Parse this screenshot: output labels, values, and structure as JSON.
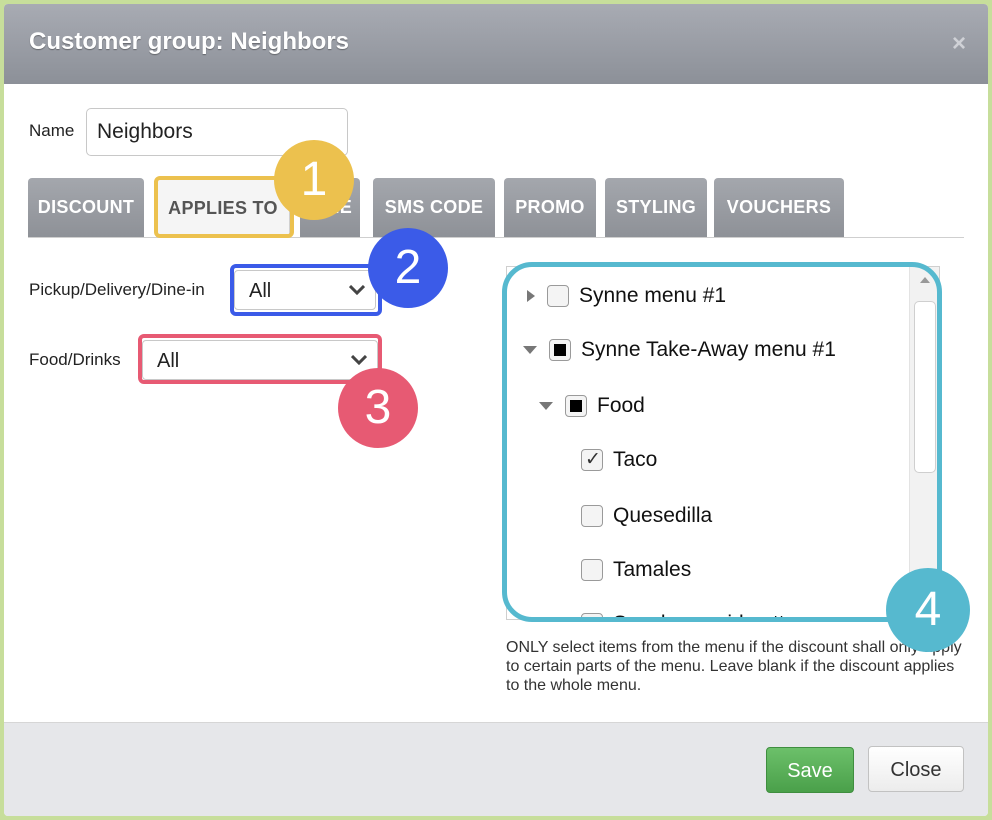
{
  "dialog": {
    "title": "Customer group: Neighbors",
    "close_glyph": "×"
  },
  "name": {
    "label": "Name",
    "value": "Neighbors"
  },
  "tabs": [
    {
      "label": "DISCOUNT",
      "active": false
    },
    {
      "label": "APPLIES TO",
      "active": true
    },
    {
      "label": "TIME",
      "active": false
    },
    {
      "label": "SMS CODE",
      "active": false
    },
    {
      "label": "PROMO",
      "active": false
    },
    {
      "label": "STYLING",
      "active": false
    },
    {
      "label": "VOUCHERS",
      "active": false
    }
  ],
  "filters": {
    "pickup": {
      "label": "Pickup/Delivery/Dine-in",
      "value": "All"
    },
    "food": {
      "label": "Food/Drinks",
      "value": "All"
    }
  },
  "menu_tree": [
    {
      "label": "Synne menu #1",
      "arrow": "right",
      "state": "unchecked"
    },
    {
      "label": "Synne Take-Away menu #1",
      "arrow": "down",
      "state": "partial"
    },
    {
      "label": "Food",
      "arrow": "down",
      "state": "partial"
    },
    {
      "label": "Taco",
      "arrow": "none",
      "state": "checked"
    },
    {
      "label": "Quesedilla",
      "arrow": "none",
      "state": "unchecked"
    },
    {
      "label": "Tamales",
      "arrow": "none",
      "state": "unchecked"
    },
    {
      "label": "Snacks on side ott",
      "arrow": "none",
      "state": "unchecked"
    }
  ],
  "hint": "ONLY select items from the menu if the discount shall only apply to certain parts of the menu. Leave blank if the discount applies to the whole menu.",
  "footer": {
    "save_label": "Save",
    "close_label": "Close"
  },
  "annotations": [
    {
      "number": "1",
      "color": "#ecc14e"
    },
    {
      "number": "2",
      "color": "#3b5be8"
    },
    {
      "number": "3",
      "color": "#e75a73"
    },
    {
      "number": "4",
      "color": "#56b9cf"
    }
  ],
  "colors": {
    "save_button": "#5cb85c",
    "title_bar": "#9a9da4",
    "tab_inactive": "#999ca2"
  }
}
